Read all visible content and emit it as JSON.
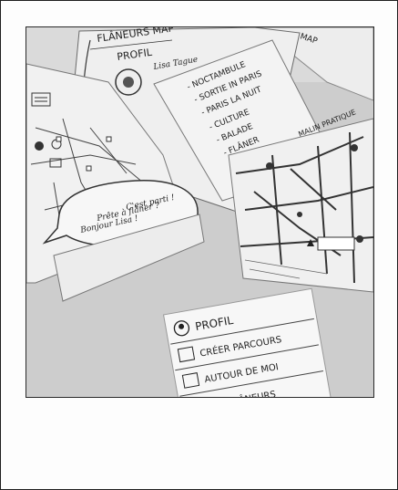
{
  "screen_a": {
    "title": "FLÂNEURS MAP",
    "profile_label": "PROFIL",
    "user_name": "Lisa Tague"
  },
  "screen_b": {
    "title": "MAP"
  },
  "interest_list": {
    "items": [
      "- NOCTAMBULE",
      "- SORTIE IN PARIS",
      "- PARIS LA NUIT",
      "- CULTURE",
      "- BALADE",
      "- FLÂNER"
    ],
    "side_note": "MALIN PRATIQUE"
  },
  "speech_bubble": {
    "lines": [
      "Bonjour Lisa !",
      "Prête à flâner ?",
      "C'est parti !"
    ]
  },
  "menu_card": {
    "items": [
      {
        "label": "PROFIL",
        "icon": "user-icon"
      },
      {
        "label": "CRÉER PARCOURS",
        "icon": "people-icon"
      },
      {
        "label": "AUTOUR DE MOI",
        "icon": "location-pin-icon"
      },
      {
        "label": "LES FLÂNEURS",
        "icon": "list-icon"
      }
    ]
  },
  "colors": {
    "paper": "#efefef",
    "table": "#cfcfcf",
    "ink": "#222222",
    "frame": "#1e1e1e"
  }
}
